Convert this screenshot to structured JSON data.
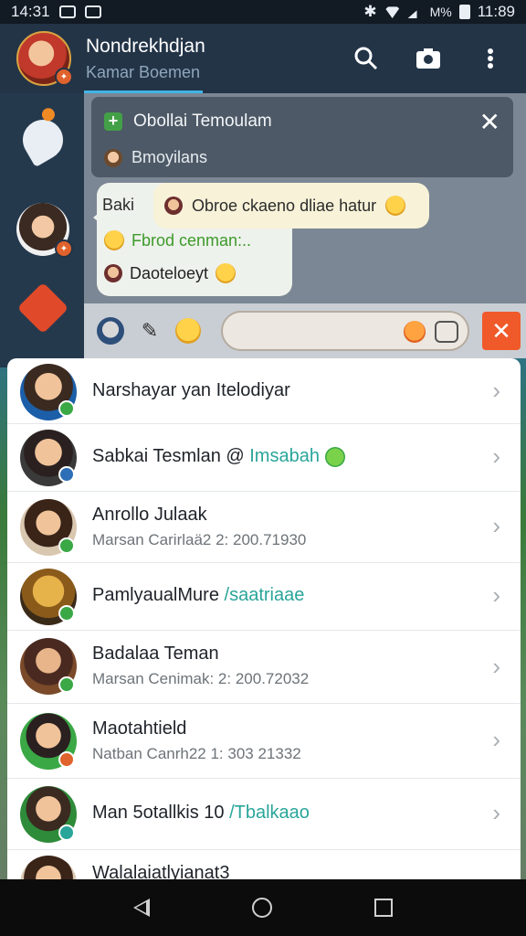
{
  "status_bar": {
    "time_left": "14:31",
    "battery_text": "M%",
    "time_right": "11:89"
  },
  "header": {
    "title": "Nondrekhdjan",
    "subtitle": "Kamar Boemen"
  },
  "pinned": {
    "title": "Obollai Temoulam",
    "subtitle": "Bmoyilans"
  },
  "chat": {
    "bubble_top": "Obroe ckaeno dliae hatur",
    "line1": "Baki",
    "line2": "Fbrod cenman:..",
    "line3": "Daoteloeyt"
  },
  "contacts": [
    {
      "name": "Narshayar yan Itelodiyar",
      "sub": "",
      "highlight": ""
    },
    {
      "name": "Sabkai Tesmlan @",
      "sub": "",
      "highlight": "Imsabah"
    },
    {
      "name": "Anrollo Julaak",
      "sub": "Marsan Carirlaä2 2: 200.71930",
      "highlight": ""
    },
    {
      "name": "PamlyaualMure",
      "sub": "",
      "highlight": "/saatriaae"
    },
    {
      "name": "Badalaa Teman",
      "sub": "Marsan Cenimak: 2: 200.72032",
      "highlight": ""
    },
    {
      "name": "Maotahtield",
      "sub": "Natban Canrh22 1: 303 21332",
      "highlight": ""
    },
    {
      "name": "Man 5otallkis 10",
      "sub": "",
      "highlight": "/Tbalkaao"
    },
    {
      "name": "Walalaiatlyianat3",
      "sub": "",
      "highlight": ""
    }
  ],
  "colors": {
    "accent": "#3fb5e8",
    "send_button": "#f0592a",
    "header_bg": "#233447",
    "highlight_text": "#2aa59a"
  }
}
